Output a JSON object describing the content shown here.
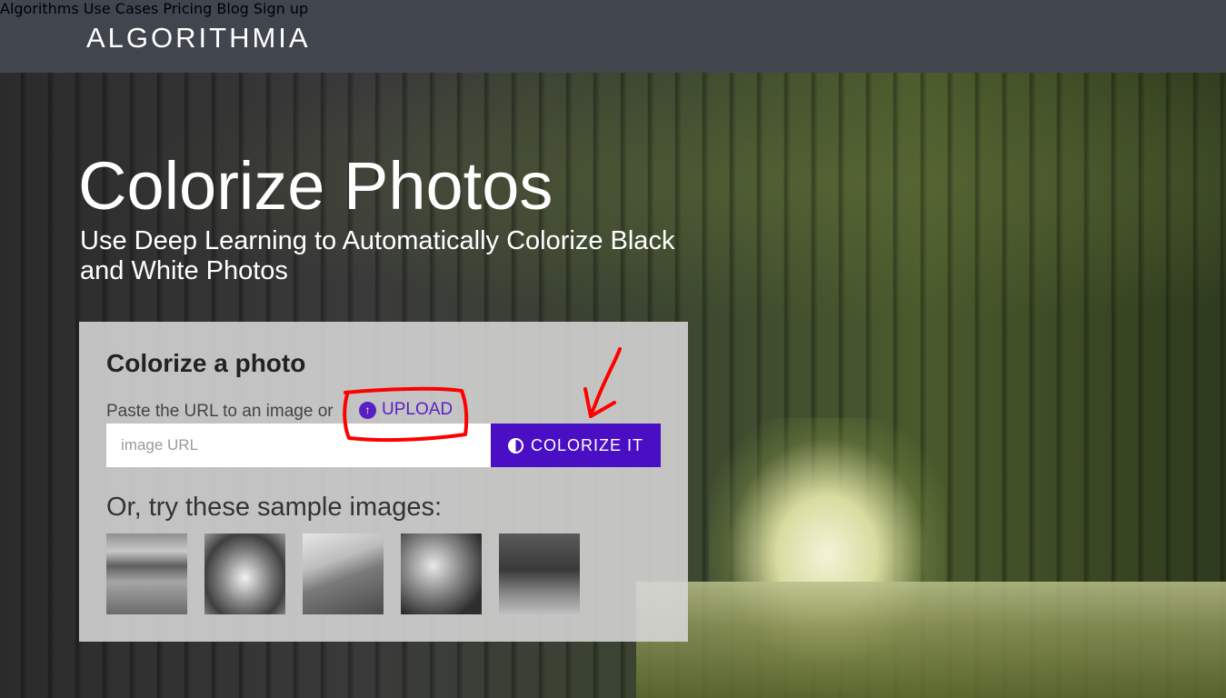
{
  "navbar": {
    "logo": "ALGORITHMIA",
    "links": [
      "Algorithms",
      "Use Cases",
      "Pricing",
      "Blog",
      "Sign up"
    ]
  },
  "hero": {
    "title": "Colorize Photos",
    "subtitle": "Use Deep Learning to Automatically Colorize Black and White Photos"
  },
  "card": {
    "title": "Colorize a photo",
    "paste_text": "Paste the URL to an image or",
    "upload_label": "UPLOAD",
    "url_placeholder": "image URL",
    "colorize_label": "COLORIZE IT",
    "try_text": "Or, try these sample images:"
  },
  "colors": {
    "navbar_bg": "#41454e",
    "accent_purple": "#4a0fc4",
    "annotation_red": "#ff0000"
  },
  "icons": [
    "upload-circle-icon",
    "half-circle-icon"
  ]
}
